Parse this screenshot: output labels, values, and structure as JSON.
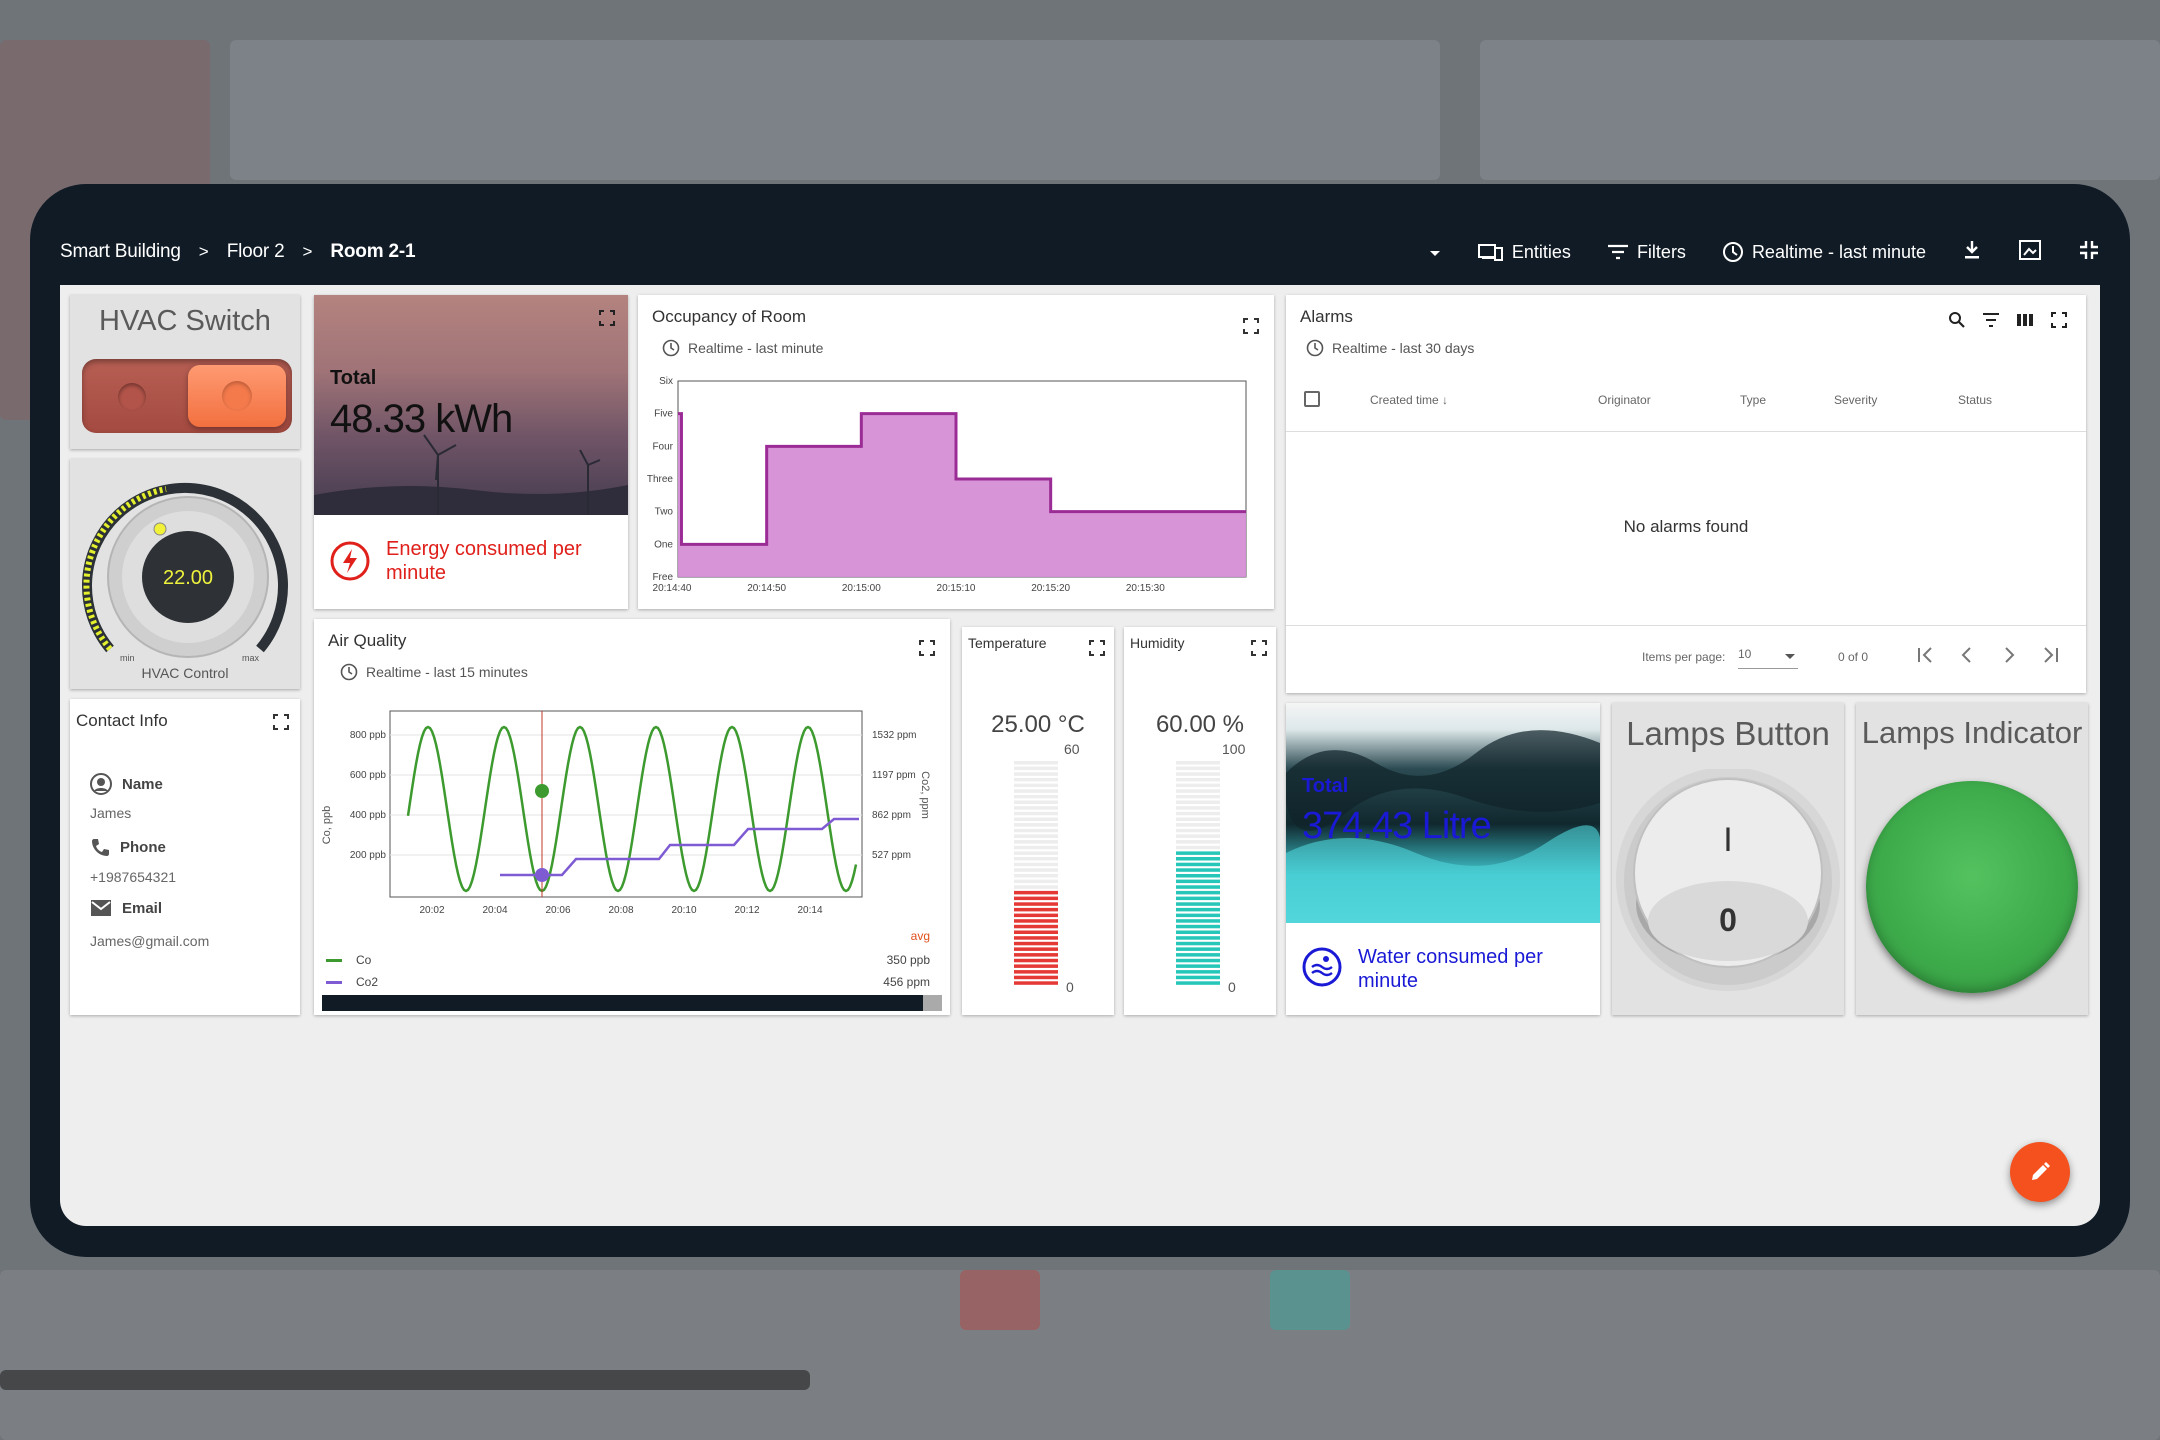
{
  "breadcrumb": {
    "items": [
      "Smart Building",
      "Floor 2",
      "Room 2-1"
    ],
    "separator": ">"
  },
  "toolbar": {
    "entities_label": "Entities",
    "filters_label": "Filters",
    "timewindow_label": "Realtime - last minute"
  },
  "hvac_switch": {
    "title": "HVAC Switch",
    "state": "on"
  },
  "hvac_control": {
    "value": "22.00",
    "label": "HVAC Control",
    "min_label": "min",
    "max_label": "max"
  },
  "energy": {
    "total_label": "Total",
    "value": "48.33 kWh",
    "description": "Energy consumed per minute",
    "accent": "#e0201b"
  },
  "occupancy": {
    "title": "Occupancy of Room",
    "timewindow": "Realtime - last minute"
  },
  "alarms": {
    "title": "Alarms",
    "timewindow": "Realtime - last 30 days",
    "columns": [
      "Created time",
      "Originator",
      "Type",
      "Severity",
      "Status"
    ],
    "empty_text": "No alarms found",
    "items_per_page_label": "Items per page:",
    "items_per_page": "10",
    "range": "0 of 0"
  },
  "contact": {
    "title": "Contact Info",
    "name_label": "Name",
    "name_value": "James",
    "phone_label": "Phone",
    "phone_value": "+1987654321",
    "email_label": "Email",
    "email_value": "James@gmail.com"
  },
  "air_quality": {
    "title": "Air Quality",
    "timewindow": "Realtime - last 15 minutes",
    "avg_label": "avg",
    "legend": [
      {
        "name": "Co",
        "avg": "350 ppb",
        "color": "#3d9a2f"
      },
      {
        "name": "Co2",
        "avg": "456 ppm",
        "color": "#7e5bd3"
      }
    ]
  },
  "temperature": {
    "title": "Temperature",
    "value": "25.00 °C",
    "max": "60",
    "min": "0",
    "level": 0.42,
    "color": "#e53935"
  },
  "humidity": {
    "title": "Humidity",
    "value": "60.00 %",
    "max": "100",
    "min": "0",
    "level": 0.6,
    "color": "#26c6b8"
  },
  "water": {
    "total_label": "Total",
    "value": "374.43 Litre",
    "description": "Water consumed per minute",
    "accent": "#1a1ad6"
  },
  "lamps_button": {
    "title": "Lamps Button",
    "on_symbol": "I",
    "off_symbol": "0"
  },
  "lamps_indicator": {
    "title": "Lamps Indicator",
    "state": "on",
    "color": "#3fb34f"
  },
  "chart_data": [
    {
      "type": "line",
      "title": "Occupancy of Room",
      "x": [
        "20:14:40",
        "20:14:50",
        "20:15:00",
        "20:15:10",
        "20:15:20",
        "20:15:30"
      ],
      "ytick_labels": [
        "Free",
        "One",
        "Two",
        "Three",
        "Four",
        "Five",
        "Six"
      ],
      "ylim": [
        0,
        6
      ],
      "series": [
        {
          "values": [
            5,
            1,
            1,
            4,
            5,
            3,
            3,
            2,
            2
          ],
          "x": [
            "20:14:40",
            "20:14:41",
            "20:14:50",
            "20:14:50",
            "20:15:00",
            "20:15:10",
            "20:15:20",
            "20:15:20",
            "20:15:36"
          ]
        }
      ]
    },
    {
      "type": "line",
      "title": "Air Quality",
      "x": [
        "20:02",
        "20:04",
        "20:06",
        "20:08",
        "20:10",
        "20:12",
        "20:14"
      ],
      "ylabel": "Co, ppb",
      "y2label": "Co2, ppm",
      "yticks": [
        "200 ppb",
        "400 ppb",
        "600 ppb",
        "800 ppb"
      ],
      "y2ticks": [
        "527 ppm",
        "862 ppm",
        "1197 ppm",
        "1532 ppm"
      ],
      "series": [
        {
          "name": "Co",
          "avg": "350 ppb"
        },
        {
          "name": "Co2",
          "avg": "456 ppm"
        }
      ]
    }
  ]
}
